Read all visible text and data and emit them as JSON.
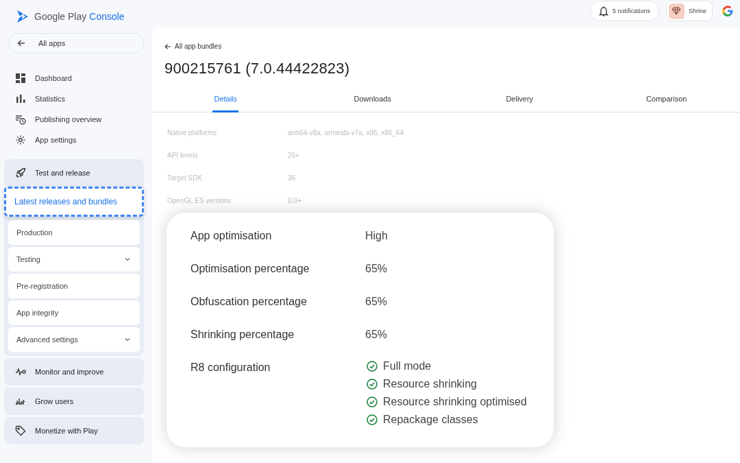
{
  "logo": {
    "brand": "Google Play",
    "product": "Console"
  },
  "header": {
    "notifications": "5 notifications",
    "account": "Shrine"
  },
  "sidebar": {
    "back": "All apps",
    "items": [
      {
        "label": "Dashboard"
      },
      {
        "label": "Statistics"
      },
      {
        "label": "Publishing overview"
      },
      {
        "label": "App settings"
      }
    ],
    "groups": [
      {
        "label": "Test and release",
        "expanded": true,
        "children": [
          {
            "label": "Latest releases and bundles",
            "selected": true,
            "expandable": false
          },
          {
            "label": "Production",
            "selected": false,
            "expandable": false
          },
          {
            "label": "Testing",
            "selected": false,
            "expandable": true
          },
          {
            "label": "Pre-registration",
            "selected": false,
            "expandable": false
          },
          {
            "label": "App integrity",
            "selected": false,
            "expandable": false
          },
          {
            "label": "Advanced settings",
            "selected": false,
            "expandable": true
          }
        ]
      },
      {
        "label": "Monitor and improve",
        "expanded": false
      },
      {
        "label": "Grow users",
        "expanded": false
      },
      {
        "label": "Monetize with Play",
        "expanded": false
      }
    ]
  },
  "breadcrumb": "All app bundles",
  "title": "900215761 (7.0.44422823)",
  "tabs": [
    {
      "label": "Details",
      "selected": true
    },
    {
      "label": "Downloads",
      "selected": false
    },
    {
      "label": "Delivery",
      "selected": false
    },
    {
      "label": "Comparison",
      "selected": false
    }
  ],
  "background_rows": [
    {
      "label": "Native platforms",
      "value": "arm64-v8a, armeabi-v7a, x86, x86_64"
    },
    {
      "label": "API levels",
      "value": "26+"
    },
    {
      "label": "Target SDK",
      "value": "36"
    },
    {
      "label": "OpenGL ES versions",
      "value": "0.0+"
    }
  ],
  "details_card": {
    "rows": [
      {
        "label": "App optimisation",
        "value": "High"
      },
      {
        "label": "Optimisation percentage",
        "value": "65%"
      },
      {
        "label": "Obfuscation percentage",
        "value": "65%"
      },
      {
        "label": "Shrinking percentage",
        "value": "65%"
      }
    ],
    "r8": {
      "label": "R8 configuration",
      "options": [
        {
          "label": "Full mode",
          "checked": true
        },
        {
          "label": "Resource shrinking",
          "checked": true
        },
        {
          "label": "Resource shrinking optimised",
          "checked": true
        },
        {
          "label": "Repackage classes",
          "checked": true
        }
      ]
    }
  }
}
